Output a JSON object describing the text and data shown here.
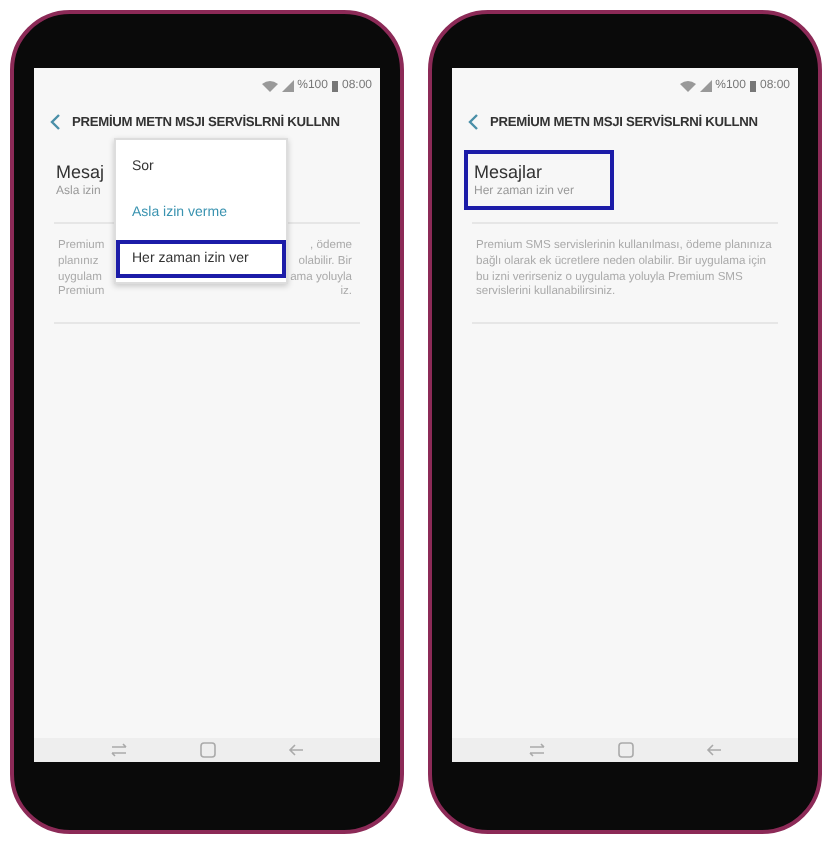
{
  "phones": [
    {
      "status": {
        "battery": "%100",
        "time": "08:00"
      },
      "title": "PREMİUM METN MSJI SERVİSLRNİ KULLNN",
      "setting": {
        "title": "Mesaj",
        "subtitle": "Asla izin",
        "highlighted": false
      },
      "description_lines": [
        {
          "left": "Premium",
          "right": ", ödeme"
        },
        {
          "left": "planınız",
          "right": "olabilir. Bir"
        },
        {
          "left": "uygulam",
          "right": "ama yoluyla"
        },
        {
          "left": "Premium",
          "right": "iz."
        }
      ],
      "menu": [
        {
          "label": "Sor",
          "selected": false,
          "highlighted": false
        },
        {
          "label": "Asla izin verme",
          "selected": true,
          "highlighted": false
        },
        {
          "label": "Her zaman izin ver",
          "selected": false,
          "highlighted": true
        }
      ]
    },
    {
      "status": {
        "battery": "%100",
        "time": "08:00"
      },
      "title": "PREMİUM METN MSJI SERVİSLRNİ KULLNN",
      "setting": {
        "title": "Mesajlar",
        "subtitle": "Her zaman izin ver",
        "highlighted": true
      },
      "description": "Premium SMS servislerinin kullanılması, ödeme planınıza bağlı olarak ek ücretlere neden olabilir. Bir uygulama için bu izni verirseniz o uygulama yoluyla Premium SMS servislerini kullanabilirsiniz."
    }
  ]
}
